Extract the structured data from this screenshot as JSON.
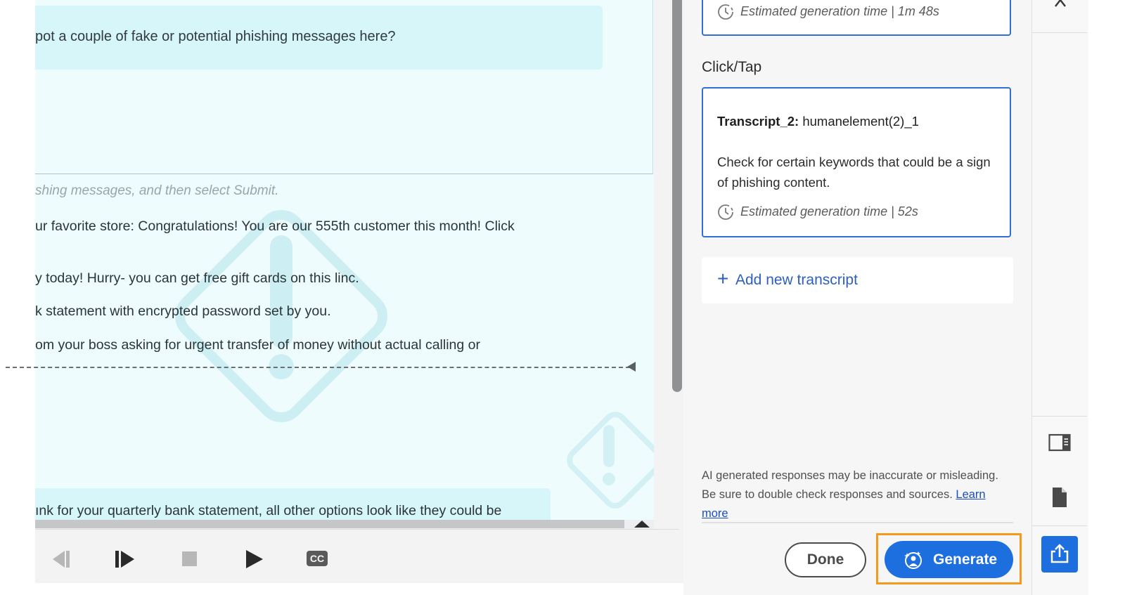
{
  "slide": {
    "question": "pot a couple of fake or potential phishing messages here?",
    "instruction": "shing messages, and then select Submit.",
    "options": [
      "ur favorite store: Congratulations! You are our 555th customer this month! Click",
      "y today! Hurry- you can get free gift cards on this linc.",
      "k statement with encrypted password set by you.",
      "om your boss asking for urgent transfer of money without actual calling or"
    ],
    "feedback": "ınk for your quarterly bank statement, all other options look like they could be"
  },
  "playback": {
    "icons": [
      "skip-back-icon",
      "step-forward-icon",
      "stop-icon",
      "play-icon",
      "closed-captions-icon"
    ],
    "cc_label": "CC"
  },
  "panel": {
    "card1": {
      "estimate": "Estimated generation time | 1m 48s"
    },
    "section_label": "Click/Tap",
    "card2": {
      "title_bold": "Transcript_2:",
      "title_rest": " humanelement(2)_1",
      "description": "Check for certain keywords that could be a sign of phishing content.",
      "estimate": "Estimated generation time | 52s"
    },
    "add_transcript": {
      "icon": "plus",
      "label": "Add new transcript"
    },
    "disclaimer": {
      "text": "AI generated responses may be inaccurate or misleading. Be sure to double check responses and sources. ",
      "link": "Learn more"
    },
    "done_label": "Done",
    "generate_label": "Generate"
  },
  "toolbar": {
    "icons": [
      "chevron-up-icon",
      "panel-toggle-icon",
      "document-icon",
      "share-icon"
    ]
  },
  "colors": {
    "accent": "#1d6fe0",
    "highlight": "#f29a1c",
    "slide_bg": "#eefcfd",
    "slide_box": "#d6f6f9"
  }
}
